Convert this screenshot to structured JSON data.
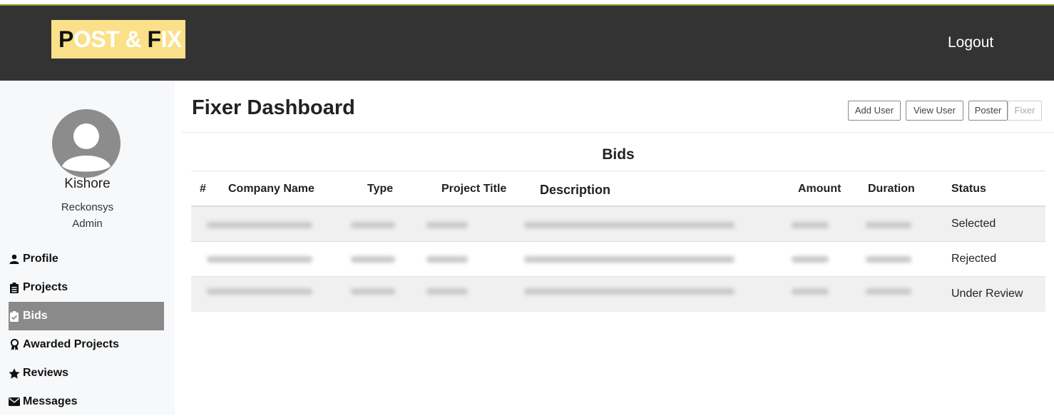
{
  "header": {
    "logo": {
      "p": "P",
      "ost": "OST & ",
      "f": "F",
      "ix": "IX"
    },
    "logout_label": "Logout"
  },
  "colors": {
    "navbar": "#333333",
    "logo_bg": "#fbe08a",
    "active_nav": "#8a8a8a",
    "accent_line": "#7fa32a"
  },
  "profile": {
    "name": "Kishore",
    "company": "Reckonsys",
    "role": "Admin"
  },
  "sidebar": {
    "items": [
      {
        "label": "Profile",
        "icon": "user-icon"
      },
      {
        "label": "Projects",
        "icon": "clipboard-icon"
      },
      {
        "label": "Bids",
        "icon": "clipboard-check-icon",
        "active": true
      },
      {
        "label": "Awarded Projects",
        "icon": "award-icon"
      },
      {
        "label": "Reviews",
        "icon": "star-icon"
      },
      {
        "label": "Messages",
        "icon": "envelope-icon"
      }
    ]
  },
  "main": {
    "title": "Fixer Dashboard",
    "buttons": {
      "add_user": "Add User",
      "view_user": "View User",
      "poster": "Poster",
      "fixer": "Fixer"
    },
    "section_title": "Bids"
  },
  "table": {
    "columns": [
      "#",
      "Company Name",
      "Type",
      "Project Title",
      "Description",
      "Amount",
      "Duration",
      "Status"
    ],
    "rows": [
      {
        "status": "Selected"
      },
      {
        "status": "Rejected"
      },
      {
        "status": "Under Review"
      }
    ]
  }
}
